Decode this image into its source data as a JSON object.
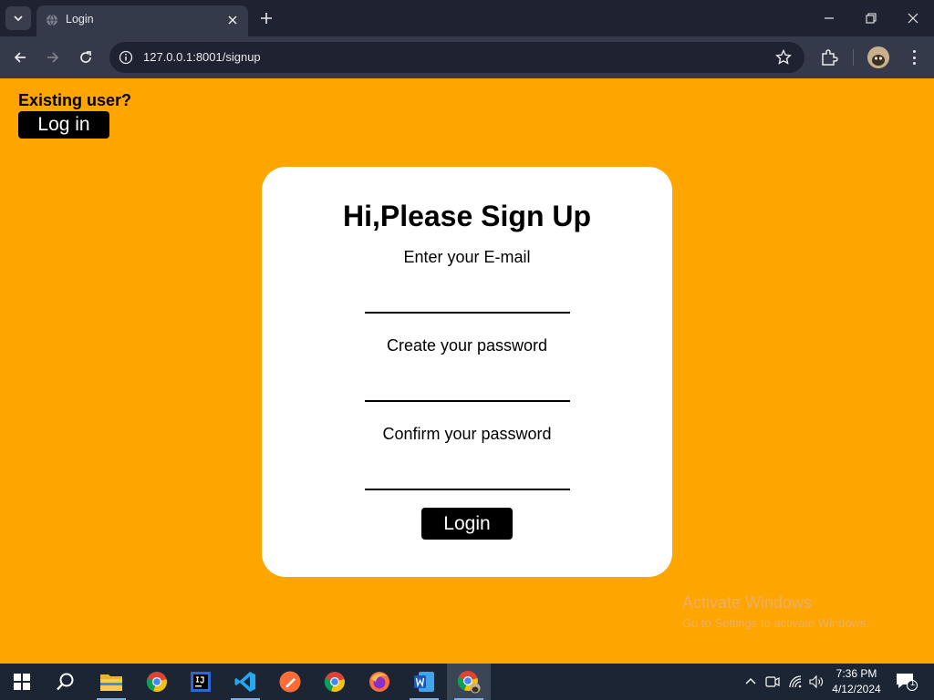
{
  "browser": {
    "tab_title": "Login",
    "url": "127.0.0.1:8001/signup"
  },
  "page": {
    "existing_user_label": "Existing user?",
    "login_link_label": "Log in",
    "card": {
      "title": "Hi,Please Sign Up",
      "email_label": "Enter your E-mail",
      "email_value": "",
      "password_label": "Create your password",
      "password_value": "",
      "confirm_label": "Confirm your password",
      "confirm_value": "",
      "submit_label": "Login"
    },
    "watermark": {
      "title": "Activate Windows",
      "subtitle": "Go to Settings to activate Windows."
    }
  },
  "taskbar": {
    "apps": [
      "start-icon",
      "search-icon",
      "file-explorer-icon",
      "chrome-icon",
      "intellij-icon",
      "vscode-icon",
      "postman-icon",
      "chrome-icon",
      "firefox-icon",
      "word-icon",
      "chrome-profile-icon"
    ],
    "time": "7:36 PM",
    "date": "4/12/2024",
    "notification_count": "1"
  },
  "colors": {
    "page_background": "#ffa500",
    "card_background": "#ffffff",
    "button_background": "#000000",
    "chrome_dark": "#1f2230",
    "chrome_toolbar": "#353a4a",
    "taskbar": "#1b2533"
  }
}
